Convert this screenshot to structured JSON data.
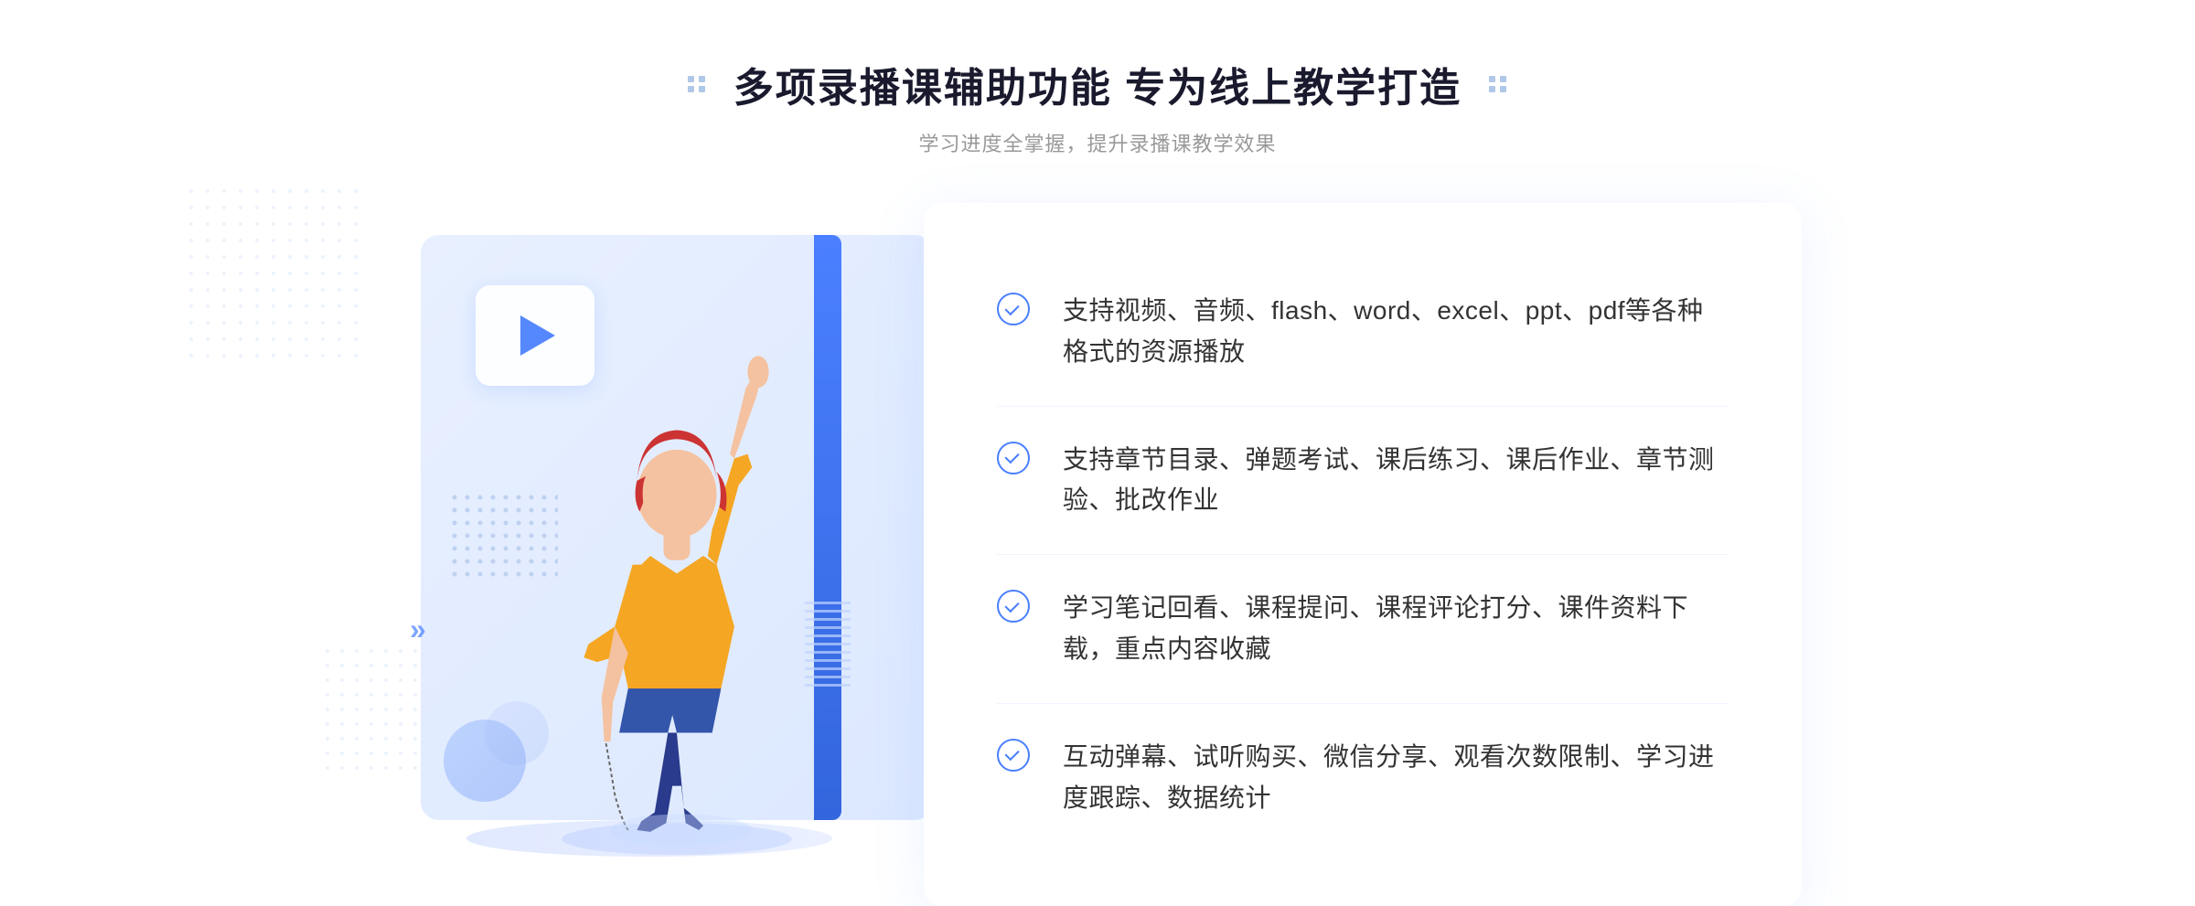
{
  "header": {
    "title": "多项录播课辅助功能 专为线上教学打造",
    "subtitle": "学习进度全掌握，提升录播课教学效果"
  },
  "features": [
    {
      "id": "feature-1",
      "text": "支持视频、音频、flash、word、excel、ppt、pdf等各种格式的资源播放"
    },
    {
      "id": "feature-2",
      "text": "支持章节目录、弹题考试、课后练习、课后作业、章节测验、批改作业"
    },
    {
      "id": "feature-3",
      "text": "学习笔记回看、课程提问、课程评论打分、课件资料下载，重点内容收藏"
    },
    {
      "id": "feature-4",
      "text": "互动弹幕、试听购买、微信分享、观看次数限制、学习进度跟踪、数据统计"
    }
  ]
}
